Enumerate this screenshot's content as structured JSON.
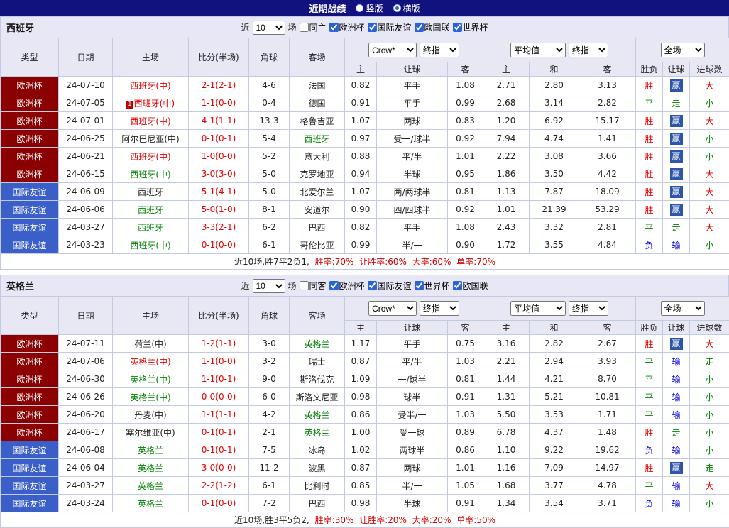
{
  "colors": {
    "topbar_bg": "#12127e",
    "euro_cup_bg": "#8b0000",
    "friendly_bg": "#3a5fc8",
    "win_text": "#e30000",
    "draw_text": "#008000",
    "lose_text": "#0000e0",
    "handicap_win_badge_bg": "#2d55aa",
    "big_text": "#e30000",
    "small_text": "#008000"
  },
  "top_bar": {
    "title": "近期战绩",
    "layout_options": [
      {
        "label": "竖版",
        "selected": false
      },
      {
        "label": "横版",
        "selected": true
      }
    ]
  },
  "tables": [
    {
      "team": "西班牙",
      "filters": {
        "recent_label": "近",
        "count_value": "10",
        "matches_label": "场",
        "same_venue": {
          "label": "同主",
          "checked": false
        },
        "leagues": [
          {
            "label": "欧洲杯",
            "checked": true
          },
          {
            "label": "国际友谊",
            "checked": true
          },
          {
            "label": "欧国联",
            "checked": true
          },
          {
            "label": "世界杯",
            "checked": true
          }
        ]
      },
      "header": {
        "type": "类型",
        "date": "日期",
        "home": "主场",
        "score": "比分(半场)",
        "corner": "角球",
        "away": "客场",
        "bookmaker_select": "Crow*",
        "bookmaker_stage_select": "终指",
        "average_select": "平均值",
        "average_stage_select": "终指",
        "fulltime_select": "全场",
        "sub_headers": [
          "主",
          "让球",
          "客",
          "主",
          "和",
          "客",
          "胜负",
          "让球",
          "进球数"
        ]
      },
      "rows": [
        {
          "type": "欧洲杯",
          "type_class": "euro",
          "date": "24-07-10",
          "home": "西班牙(中)",
          "home_color": "red",
          "home_badge": false,
          "score": "2-1(2-1)",
          "corner": "4-6",
          "away": "法国",
          "away_color": "black",
          "odds1": [
            "0.82",
            "平手",
            "1.08"
          ],
          "odds2": [
            "2.71",
            "2.80",
            "3.13"
          ],
          "result": "胜",
          "result_class": "win",
          "hcp_result": "赢",
          "hcp_class": "ying",
          "goal_result": "大",
          "goal_class": "big"
        },
        {
          "type": "欧洲杯",
          "type_class": "euro",
          "date": "24-07-05",
          "home": "西班牙(中)",
          "home_color": "red",
          "home_badge": true,
          "score": "1-1(0-0)",
          "corner": "0-4",
          "away": "德国",
          "away_color": "black",
          "odds1": [
            "0.91",
            "平手",
            "0.99"
          ],
          "odds2": [
            "2.68",
            "3.14",
            "2.82"
          ],
          "result": "平",
          "result_class": "draw",
          "hcp_result": "走",
          "hcp_class": "zou",
          "goal_result": "小",
          "goal_class": "small"
        },
        {
          "type": "欧洲杯",
          "type_class": "euro",
          "date": "24-07-01",
          "home": "西班牙(中)",
          "home_color": "red",
          "home_badge": false,
          "score": "4-1(1-1)",
          "corner": "13-3",
          "away": "格鲁吉亚",
          "away_color": "black",
          "odds1": [
            "1.07",
            "两球",
            "0.83"
          ],
          "odds2": [
            "1.20",
            "6.92",
            "15.17"
          ],
          "result": "胜",
          "result_class": "win",
          "hcp_result": "赢",
          "hcp_class": "ying",
          "goal_result": "大",
          "goal_class": "big"
        },
        {
          "type": "欧洲杯",
          "type_class": "euro",
          "date": "24-06-25",
          "home": "阿尔巴尼亚(中)",
          "home_color": "black",
          "home_badge": false,
          "score": "0-1(0-1)",
          "corner": "5-4",
          "away": "西班牙",
          "away_color": "green",
          "odds1": [
            "0.97",
            "受一/球半",
            "0.92"
          ],
          "odds2": [
            "7.94",
            "4.74",
            "1.41"
          ],
          "result": "胜",
          "result_class": "win",
          "hcp_result": "赢",
          "hcp_class": "ying",
          "goal_result": "小",
          "goal_class": "small"
        },
        {
          "type": "欧洲杯",
          "type_class": "euro",
          "date": "24-06-21",
          "home": "西班牙(中)",
          "home_color": "red",
          "home_badge": false,
          "score": "1-0(0-0)",
          "corner": "5-2",
          "away": "意大利",
          "away_color": "black",
          "odds1": [
            "0.88",
            "平/半",
            "1.01"
          ],
          "odds2": [
            "2.22",
            "3.08",
            "3.66"
          ],
          "result": "胜",
          "result_class": "win",
          "hcp_result": "赢",
          "hcp_class": "ying",
          "goal_result": "小",
          "goal_class": "small"
        },
        {
          "type": "欧洲杯",
          "type_class": "euro",
          "date": "24-06-15",
          "home": "西班牙(中)",
          "home_color": "green",
          "home_badge": false,
          "score": "3-0(3-0)",
          "corner": "5-0",
          "away": "克罗地亚",
          "away_color": "black",
          "odds1": [
            "0.94",
            "半球",
            "0.95"
          ],
          "odds2": [
            "1.86",
            "3.50",
            "4.42"
          ],
          "result": "胜",
          "result_class": "win",
          "hcp_result": "赢",
          "hcp_class": "ying",
          "goal_result": "大",
          "goal_class": "big"
        },
        {
          "type": "国际友谊",
          "type_class": "friendly",
          "date": "24-06-09",
          "home": "西班牙",
          "home_color": "black",
          "home_badge": false,
          "score": "5-1(4-1)",
          "corner": "5-0",
          "away": "北爱尔兰",
          "away_color": "black",
          "odds1": [
            "1.07",
            "两/两球半",
            "0.81"
          ],
          "odds2": [
            "1.13",
            "7.87",
            "18.09"
          ],
          "result": "胜",
          "result_class": "win",
          "hcp_result": "赢",
          "hcp_class": "ying",
          "goal_result": "大",
          "goal_class": "big"
        },
        {
          "type": "国际友谊",
          "type_class": "friendly",
          "date": "24-06-06",
          "home": "西班牙",
          "home_color": "green",
          "home_badge": false,
          "score": "5-0(1-0)",
          "corner": "8-1",
          "away": "安道尔",
          "away_color": "black",
          "odds1": [
            "0.90",
            "四/四球半",
            "0.92"
          ],
          "odds2": [
            "1.01",
            "21.39",
            "53.29"
          ],
          "result": "胜",
          "result_class": "win",
          "hcp_result": "赢",
          "hcp_class": "ying",
          "goal_result": "大",
          "goal_class": "big"
        },
        {
          "type": "国际友谊",
          "type_class": "friendly",
          "date": "24-03-27",
          "home": "西班牙",
          "home_color": "green",
          "home_badge": false,
          "score": "3-3(2-1)",
          "corner": "6-2",
          "away": "巴西",
          "away_color": "black",
          "odds1": [
            "0.82",
            "平手",
            "1.08"
          ],
          "odds2": [
            "2.43",
            "3.32",
            "2.81"
          ],
          "result": "平",
          "result_class": "draw",
          "hcp_result": "走",
          "hcp_class": "zou",
          "goal_result": "大",
          "goal_class": "big"
        },
        {
          "type": "国际友谊",
          "type_class": "friendly",
          "date": "24-03-23",
          "home": "西班牙(中)",
          "home_color": "green",
          "home_badge": false,
          "score": "0-1(0-0)",
          "corner": "6-1",
          "away": "哥伦比亚",
          "away_color": "black",
          "odds1": [
            "0.99",
            "半/一",
            "0.90"
          ],
          "odds2": [
            "1.72",
            "3.55",
            "4.84"
          ],
          "result": "负",
          "result_class": "lose",
          "hcp_result": "输",
          "hcp_class": "shu",
          "goal_result": "小",
          "goal_class": "small"
        }
      ],
      "footer": {
        "summary": "近10场,胜7平2负1,",
        "stats": [
          "胜率:70%",
          "让胜率:60%",
          "大率:60%",
          "单率:70%"
        ]
      }
    },
    {
      "team": "英格兰",
      "filters": {
        "recent_label": "近",
        "count_value": "10",
        "matches_label": "场",
        "same_venue": {
          "label": "同客",
          "checked": false
        },
        "leagues": [
          {
            "label": "欧洲杯",
            "checked": true
          },
          {
            "label": "国际友谊",
            "checked": true
          },
          {
            "label": "世界杯",
            "checked": true
          },
          {
            "label": "欧国联",
            "checked": true
          }
        ]
      },
      "header": {
        "type": "类型",
        "date": "日期",
        "home": "主场",
        "score": "比分(半场)",
        "corner": "角球",
        "away": "客场",
        "bookmaker_select": "Crow*",
        "bookmaker_stage_select": "终指",
        "average_select": "平均值",
        "average_stage_select": "终指",
        "fulltime_select": "全场",
        "sub_headers": [
          "主",
          "让球",
          "客",
          "主",
          "和",
          "客",
          "胜负",
          "让球",
          "进球数"
        ]
      },
      "rows": [
        {
          "type": "欧洲杯",
          "type_class": "euro",
          "date": "24-07-11",
          "home": "荷兰(中)",
          "home_color": "black",
          "home_badge": false,
          "score": "1-2(1-1)",
          "corner": "3-0",
          "away": "英格兰",
          "away_color": "green",
          "odds1": [
            "1.17",
            "平手",
            "0.75"
          ],
          "odds2": [
            "3.16",
            "2.82",
            "2.67"
          ],
          "result": "胜",
          "result_class": "win",
          "hcp_result": "赢",
          "hcp_class": "ying",
          "goal_result": "大",
          "goal_class": "big"
        },
        {
          "type": "欧洲杯",
          "type_class": "euro",
          "date": "24-07-06",
          "home": "英格兰(中)",
          "home_color": "red",
          "home_badge": false,
          "score": "1-1(0-0)",
          "corner": "3-2",
          "away": "瑞士",
          "away_color": "black",
          "odds1": [
            "0.87",
            "平/半",
            "1.03"
          ],
          "odds2": [
            "2.21",
            "2.94",
            "3.93"
          ],
          "result": "平",
          "result_class": "draw",
          "hcp_result": "输",
          "hcp_class": "shu",
          "goal_result": "走",
          "goal_class": "zou"
        },
        {
          "type": "欧洲杯",
          "type_class": "euro",
          "date": "24-06-30",
          "home": "英格兰(中)",
          "home_color": "green",
          "home_badge": false,
          "score": "1-1(0-1)",
          "corner": "9-0",
          "away": "斯洛伐克",
          "away_color": "black",
          "odds1": [
            "1.09",
            "一/球半",
            "0.81"
          ],
          "odds2": [
            "1.44",
            "4.21",
            "8.70"
          ],
          "result": "平",
          "result_class": "draw",
          "hcp_result": "输",
          "hcp_class": "shu",
          "goal_result": "小",
          "goal_class": "small"
        },
        {
          "type": "欧洲杯",
          "type_class": "euro",
          "date": "24-06-26",
          "home": "英格兰(中)",
          "home_color": "green",
          "home_badge": false,
          "score": "0-0(0-0)",
          "corner": "6-0",
          "away": "斯洛文尼亚",
          "away_color": "black",
          "odds1": [
            "0.98",
            "球半",
            "0.91"
          ],
          "odds2": [
            "1.31",
            "5.21",
            "10.81"
          ],
          "result": "平",
          "result_class": "draw",
          "hcp_result": "输",
          "hcp_class": "shu",
          "goal_result": "小",
          "goal_class": "small"
        },
        {
          "type": "欧洲杯",
          "type_class": "euro",
          "date": "24-06-20",
          "home": "丹麦(中)",
          "home_color": "black",
          "home_badge": false,
          "score": "1-1(1-1)",
          "corner": "4-2",
          "away": "英格兰",
          "away_color": "green",
          "odds1": [
            "0.86",
            "受半/一",
            "1.03"
          ],
          "odds2": [
            "5.50",
            "3.53",
            "1.71"
          ],
          "result": "平",
          "result_class": "draw",
          "hcp_result": "输",
          "hcp_class": "shu",
          "goal_result": "小",
          "goal_class": "small"
        },
        {
          "type": "欧洲杯",
          "type_class": "euro",
          "date": "24-06-17",
          "home": "塞尔维亚(中)",
          "home_color": "black",
          "home_badge": false,
          "score": "0-1(0-1)",
          "corner": "2-1",
          "away": "英格兰",
          "away_color": "green",
          "odds1": [
            "1.00",
            "受一球",
            "0.89"
          ],
          "odds2": [
            "6.78",
            "4.37",
            "1.48"
          ],
          "result": "胜",
          "result_class": "win",
          "hcp_result": "走",
          "hcp_class": "zou",
          "goal_result": "小",
          "goal_class": "small"
        },
        {
          "type": "国际友谊",
          "type_class": "friendly",
          "date": "24-06-08",
          "home": "英格兰",
          "home_color": "green",
          "home_badge": false,
          "score": "0-1(0-1)",
          "corner": "7-5",
          "away": "冰岛",
          "away_color": "black",
          "odds1": [
            "1.02",
            "两球半",
            "0.86"
          ],
          "odds2": [
            "1.10",
            "9.22",
            "19.62"
          ],
          "result": "负",
          "result_class": "lose",
          "hcp_result": "输",
          "hcp_class": "shu",
          "goal_result": "小",
          "goal_class": "small"
        },
        {
          "type": "国际友谊",
          "type_class": "friendly",
          "date": "24-06-04",
          "home": "英格兰",
          "home_color": "green",
          "home_badge": false,
          "score": "3-0(0-0)",
          "corner": "11-2",
          "away": "波黑",
          "away_color": "black",
          "odds1": [
            "0.87",
            "两球",
            "1.01"
          ],
          "odds2": [
            "1.16",
            "7.09",
            "14.97"
          ],
          "result": "胜",
          "result_class": "win",
          "hcp_result": "赢",
          "hcp_class": "ying",
          "goal_result": "走",
          "goal_class": "zou"
        },
        {
          "type": "国际友谊",
          "type_class": "friendly",
          "date": "24-03-27",
          "home": "英格兰",
          "home_color": "green",
          "home_badge": false,
          "score": "2-2(1-2)",
          "corner": "6-1",
          "away": "比利时",
          "away_color": "black",
          "odds1": [
            "0.85",
            "半/一",
            "1.05"
          ],
          "odds2": [
            "1.68",
            "3.77",
            "4.78"
          ],
          "result": "平",
          "result_class": "draw",
          "hcp_result": "输",
          "hcp_class": "shu",
          "goal_result": "大",
          "goal_class": "big"
        },
        {
          "type": "国际友谊",
          "type_class": "friendly",
          "date": "24-03-24",
          "home": "英格兰",
          "home_color": "green",
          "home_badge": false,
          "score": "0-1(0-0)",
          "corner": "7-2",
          "away": "巴西",
          "away_color": "black",
          "odds1": [
            "0.98",
            "半球",
            "0.91"
          ],
          "odds2": [
            "1.34",
            "3.54",
            "3.71"
          ],
          "result": "负",
          "result_class": "lose",
          "hcp_result": "输",
          "hcp_class": "shu",
          "goal_result": "小",
          "goal_class": "small"
        }
      ],
      "footer": {
        "summary": "近10场,胜3平5负2,",
        "stats": [
          "胜率:30%",
          "让胜率:20%",
          "大率:20%",
          "单率:50%"
        ]
      }
    }
  ]
}
